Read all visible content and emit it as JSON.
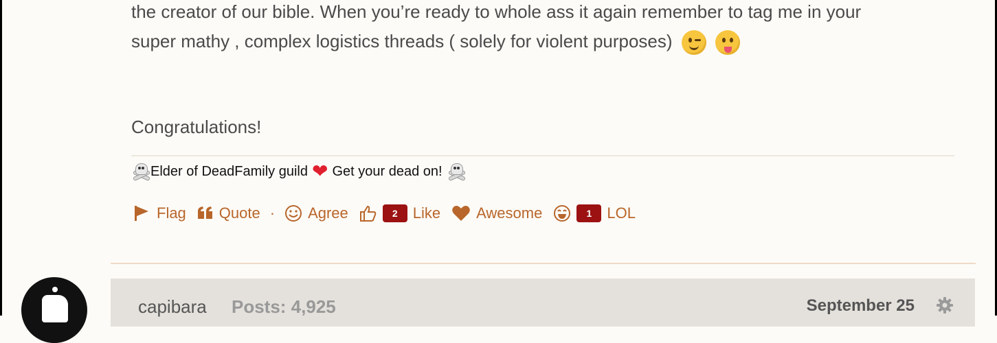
{
  "post": {
    "line1": "the creator of our bible. When you’re ready to whole ass it again remember to tag me in your",
    "line2": "super mathy , complex logistics threads ( solely for violent purposes)",
    "congratulations": "Congratulations!",
    "emojis": [
      "winking-face",
      "face-with-tongue"
    ]
  },
  "signature": {
    "left_text": "Elder of DeadFamily guild",
    "right_text": "Get your dead on!",
    "icons": [
      "skull-crossbones",
      "red-heart",
      "skull-crossbones"
    ]
  },
  "reactions": {
    "flag": "Flag",
    "quote": "Quote",
    "separator": "·",
    "agree": "Agree",
    "like": "Like",
    "like_count": "2",
    "awesome": "Awesome",
    "lol": "LOL",
    "lol_count": "1"
  },
  "next_post": {
    "author": "capibara",
    "posts": "Posts: 4,925",
    "date": "September 25"
  },
  "colors": {
    "background": "#fdfbf7",
    "accent": "#b8662b",
    "badge": "#9c1212",
    "author_bar": "#e4e1dc"
  }
}
